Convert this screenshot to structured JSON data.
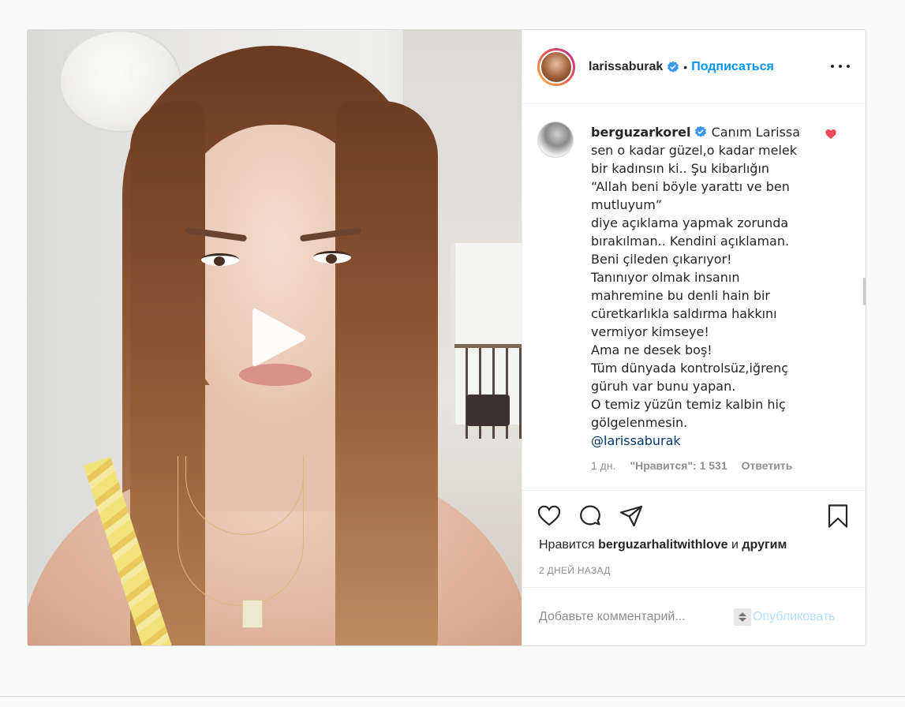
{
  "post": {
    "author": "larissaburak",
    "follow_label": "Подписаться",
    "dot": "•"
  },
  "comment": {
    "user": "berguzarkorel",
    "lines": [
      "Canım Larissa",
      "sen o kadar güzel,o kadar melek",
      "bir kadınsın ki.. Şu kibarlığın",
      "“Allah beni böyle yarattı ve ben",
      "mutluyum”",
      "diye açıklama yapmak zorunda",
      "bırakılman.. Kendini açıklaman.",
      "Beni çileden çıkarıyor!",
      "Tanınıyor olmak insanın",
      "mahremine bu denli hain bir",
      "cüretkarlıkla saldırma hakkını",
      "vermiyor kimseye!",
      "Ama ne desek boş!",
      "Tüm dünyada kontrolsüz,iğrenç",
      "güruh var bunu yapan.",
      "O temiz yüzün temiz kalbin hiç",
      "gölgelenmesin."
    ],
    "mention": "@larissaburak",
    "time": "1 дн.",
    "likes": "\"Нравится\": 1 531",
    "reply_label": "Ответить",
    "liked": true
  },
  "likes_line": {
    "prefix": "Нравится",
    "user": "berguzarhalitwithlove",
    "middle": "и",
    "others": "другим"
  },
  "post_date": "2 ДНЕЙ НАЗАД",
  "add_comment": {
    "placeholder": "Добавьте комментарий...",
    "publish_label": "Опубликовать"
  },
  "icons": {
    "play": "play-icon",
    "verified": "verified-badge-icon",
    "more": "more-options-icon",
    "like": "heart-icon",
    "comment": "comment-bubble-icon",
    "share": "paper-plane-icon",
    "save": "bookmark-icon"
  },
  "colors": {
    "accent": "#0095f6",
    "like_red": "#ed4956",
    "text": "#262626",
    "muted": "#8e8e8e"
  }
}
